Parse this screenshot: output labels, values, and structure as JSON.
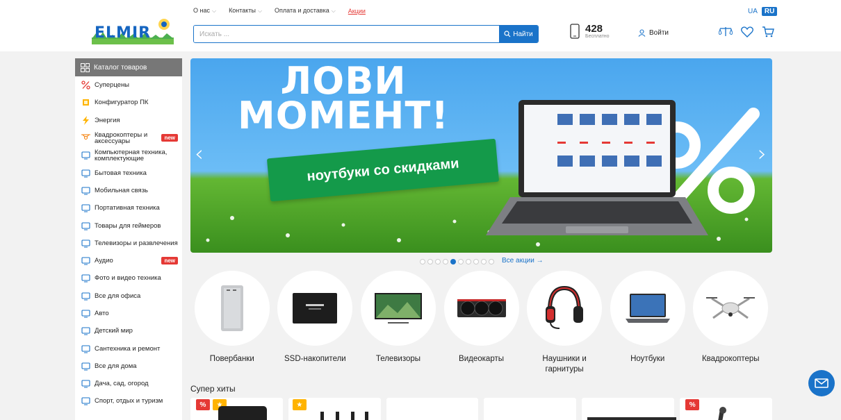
{
  "header": {
    "top_nav": [
      {
        "label": "О нас",
        "has_dropdown": true
      },
      {
        "label": "Контакты",
        "has_dropdown": true
      },
      {
        "label": "Оплата и доставка",
        "has_dropdown": true
      },
      {
        "label": "Акции",
        "has_dropdown": false
      }
    ],
    "lang": {
      "ua": "UA",
      "ru": "RU",
      "active": "RU"
    },
    "logo_text": "ELMIR",
    "search": {
      "placeholder": "Искать ...",
      "button": "Найти"
    },
    "phone": {
      "number": "428",
      "sub": "Бесплатно"
    },
    "login": "Войти",
    "icons": [
      "compare-icon",
      "heart-icon",
      "cart-icon"
    ]
  },
  "sidebar": {
    "title": "Каталог товаров",
    "items": [
      {
        "label": "Суперцены",
        "icon": "percent-icon",
        "badge": ""
      },
      {
        "label": "Конфигуратор ПК",
        "icon": "chip-icon",
        "badge": ""
      },
      {
        "label": "Энергия",
        "icon": "lightning-icon",
        "badge": ""
      },
      {
        "label": "Квадрокоптеры и аксессуары",
        "icon": "drone-icon",
        "badge": "new"
      },
      {
        "label": "Компьютерная техника, комплектующие",
        "icon": "monitor-icon",
        "badge": ""
      },
      {
        "label": "Бытовая техника",
        "icon": "washer-icon",
        "badge": ""
      },
      {
        "label": "Мобильная связь",
        "icon": "phone-icon",
        "badge": ""
      },
      {
        "label": "Портативная техника",
        "icon": "laptop-icon",
        "badge": ""
      },
      {
        "label": "Товары для геймеров",
        "icon": "gamepad-icon",
        "badge": ""
      },
      {
        "label": "Телевизоры и развлечения",
        "icon": "tv-icon",
        "badge": ""
      },
      {
        "label": "Аудио",
        "icon": "audio-icon",
        "badge": "new"
      },
      {
        "label": "Фото и видео техника",
        "icon": "camera-icon",
        "badge": ""
      },
      {
        "label": "Все для офиса",
        "icon": "printer-icon",
        "badge": ""
      },
      {
        "label": "Авто",
        "icon": "car-icon",
        "badge": ""
      },
      {
        "label": "Детский мир",
        "icon": "stroller-icon",
        "badge": ""
      },
      {
        "label": "Сантехника и ремонт",
        "icon": "tap-icon",
        "badge": ""
      },
      {
        "label": "Все для дома",
        "icon": "sofa-icon",
        "badge": ""
      },
      {
        "label": "Дача, сад, огород",
        "icon": "garden-icon",
        "badge": ""
      },
      {
        "label": "Спорт, отдых и туризм",
        "icon": "bike-icon",
        "badge": ""
      }
    ]
  },
  "banner": {
    "title_line1": "ЛОВИ",
    "title_line2": "МОМЕНТ!",
    "ribbon": "ноутбуки со скидками",
    "slides": 10,
    "active_slide": 5,
    "all_promos": "Все акции →",
    "prev": "‹",
    "next": "›"
  },
  "categories": [
    {
      "name": "Повербанки",
      "icon": "powerbank-icon"
    },
    {
      "name": "SSD-накопители",
      "icon": "ssd-icon"
    },
    {
      "name": "Телевизоры",
      "icon": "tv-icon"
    },
    {
      "name": "Видеокарты",
      "icon": "gpu-icon"
    },
    {
      "name": "Наушники и гарнитуры",
      "icon": "headset-icon"
    },
    {
      "name": "Ноутбуки",
      "icon": "laptop-icon"
    },
    {
      "name": "Квадрокоптеры",
      "icon": "drone-icon"
    }
  ],
  "super_hits": {
    "title": "Супер хиты",
    "cards": [
      {
        "tags": [
          "percent",
          "star"
        ]
      },
      {
        "tags": [
          "star"
        ]
      },
      {
        "tags": []
      },
      {
        "tags": []
      },
      {
        "tags": []
      },
      {
        "tags": [
          "percent"
        ]
      }
    ]
  },
  "colors": {
    "accent": "#1a73c9",
    "sale": "#e53935",
    "hit": "#ffb300",
    "banner_green": "#149a4a"
  }
}
